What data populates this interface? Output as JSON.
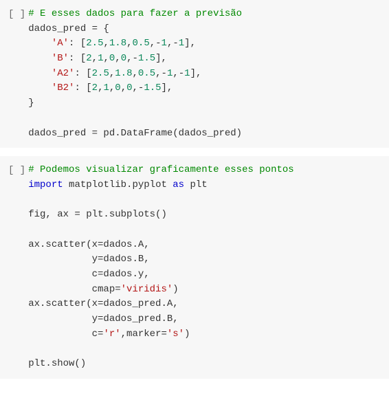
{
  "cells": [
    {
      "bracket": "[ ]",
      "lines": [
        [
          {
            "cls": "c-comment",
            "t": "# E esses dados para fazer a previsão"
          }
        ],
        [
          {
            "cls": "",
            "t": "dados_pred = {"
          }
        ],
        [
          {
            "cls": "",
            "t": "    "
          },
          {
            "cls": "c-str",
            "t": "'A'"
          },
          {
            "cls": "",
            "t": ": ["
          },
          {
            "cls": "c-num",
            "t": "2.5"
          },
          {
            "cls": "",
            "t": ","
          },
          {
            "cls": "c-num",
            "t": "1.8"
          },
          {
            "cls": "",
            "t": ","
          },
          {
            "cls": "c-num",
            "t": "0.5"
          },
          {
            "cls": "",
            "t": ",-"
          },
          {
            "cls": "c-num",
            "t": "1"
          },
          {
            "cls": "",
            "t": ",-"
          },
          {
            "cls": "c-num",
            "t": "1"
          },
          {
            "cls": "",
            "t": "],"
          }
        ],
        [
          {
            "cls": "",
            "t": "    "
          },
          {
            "cls": "c-str",
            "t": "'B'"
          },
          {
            "cls": "",
            "t": ": ["
          },
          {
            "cls": "c-num",
            "t": "2"
          },
          {
            "cls": "",
            "t": ","
          },
          {
            "cls": "c-num",
            "t": "1"
          },
          {
            "cls": "",
            "t": ","
          },
          {
            "cls": "c-num",
            "t": "0"
          },
          {
            "cls": "",
            "t": ","
          },
          {
            "cls": "c-num",
            "t": "0"
          },
          {
            "cls": "",
            "t": ",-"
          },
          {
            "cls": "c-num",
            "t": "1.5"
          },
          {
            "cls": "",
            "t": "],"
          }
        ],
        [
          {
            "cls": "",
            "t": "    "
          },
          {
            "cls": "c-str",
            "t": "'A2'"
          },
          {
            "cls": "",
            "t": ": ["
          },
          {
            "cls": "c-num",
            "t": "2.5"
          },
          {
            "cls": "",
            "t": ","
          },
          {
            "cls": "c-num",
            "t": "1.8"
          },
          {
            "cls": "",
            "t": ","
          },
          {
            "cls": "c-num",
            "t": "0.5"
          },
          {
            "cls": "",
            "t": ",-"
          },
          {
            "cls": "c-num",
            "t": "1"
          },
          {
            "cls": "",
            "t": ",-"
          },
          {
            "cls": "c-num",
            "t": "1"
          },
          {
            "cls": "",
            "t": "],"
          }
        ],
        [
          {
            "cls": "",
            "t": "    "
          },
          {
            "cls": "c-str",
            "t": "'B2'"
          },
          {
            "cls": "",
            "t": ": ["
          },
          {
            "cls": "c-num",
            "t": "2"
          },
          {
            "cls": "",
            "t": ","
          },
          {
            "cls": "c-num",
            "t": "1"
          },
          {
            "cls": "",
            "t": ","
          },
          {
            "cls": "c-num",
            "t": "0"
          },
          {
            "cls": "",
            "t": ","
          },
          {
            "cls": "c-num",
            "t": "0"
          },
          {
            "cls": "",
            "t": ",-"
          },
          {
            "cls": "c-num",
            "t": "1.5"
          },
          {
            "cls": "",
            "t": "],"
          }
        ],
        [
          {
            "cls": "",
            "t": "}"
          }
        ],
        [
          {
            "cls": "",
            "t": ""
          }
        ],
        [
          {
            "cls": "",
            "t": "dados_pred = pd.DataFrame(dados_pred)"
          }
        ]
      ]
    },
    {
      "bracket": "[ ]",
      "lines": [
        [
          {
            "cls": "c-comment",
            "t": "# Podemos visualizar graficamente esses pontos"
          }
        ],
        [
          {
            "cls": "c-kw",
            "t": "import"
          },
          {
            "cls": "",
            "t": " matplotlib.pyplot "
          },
          {
            "cls": "c-kw",
            "t": "as"
          },
          {
            "cls": "",
            "t": " plt"
          }
        ],
        [
          {
            "cls": "",
            "t": ""
          }
        ],
        [
          {
            "cls": "",
            "t": "fig, ax = plt.subplots()"
          }
        ],
        [
          {
            "cls": "",
            "t": ""
          }
        ],
        [
          {
            "cls": "",
            "t": "ax.scatter(x=dados.A,"
          }
        ],
        [
          {
            "cls": "",
            "t": "           y=dados.B,"
          }
        ],
        [
          {
            "cls": "",
            "t": "           c=dados.y,"
          }
        ],
        [
          {
            "cls": "",
            "t": "           cmap="
          },
          {
            "cls": "c-str",
            "t": "'viridis'"
          },
          {
            "cls": "",
            "t": ")"
          }
        ],
        [
          {
            "cls": "",
            "t": "ax.scatter(x=dados_pred.A,"
          }
        ],
        [
          {
            "cls": "",
            "t": "           y=dados_pred.B,"
          }
        ],
        [
          {
            "cls": "",
            "t": "           c="
          },
          {
            "cls": "c-str",
            "t": "'r'"
          },
          {
            "cls": "",
            "t": ",marker="
          },
          {
            "cls": "c-str",
            "t": "'s'"
          },
          {
            "cls": "",
            "t": ")"
          }
        ],
        [
          {
            "cls": "",
            "t": ""
          }
        ],
        [
          {
            "cls": "",
            "t": "plt.show()"
          }
        ]
      ]
    }
  ]
}
